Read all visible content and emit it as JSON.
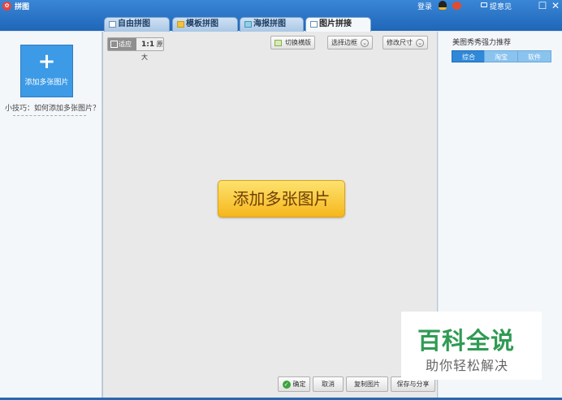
{
  "window": {
    "title": "拼图",
    "login_label": "登录",
    "feedback_label": "提意见",
    "maximize_glyph": "☐",
    "close_glyph": "✕",
    "accent_color": "#2c74c6"
  },
  "tabs": [
    {
      "label": "自由拼图",
      "icon": "free-collage-icon",
      "active": false
    },
    {
      "label": "模板拼图",
      "icon": "template-collage-icon",
      "active": false
    },
    {
      "label": "海报拼图",
      "icon": "poster-collage-icon",
      "active": false
    },
    {
      "label": "图片拼接",
      "icon": "image-stitch-icon",
      "active": true
    }
  ],
  "left_panel": {
    "add_glyph": "+",
    "add_button_label": "添加多张图片",
    "tip": "小技巧：如何添加多张图片？"
  },
  "canvas_toolbar": {
    "fit_label": "适应",
    "original_ratio": "1:1",
    "original_label": "原大",
    "switch_label": "切换横版",
    "border_label": "选择边框",
    "resize_label": "修改尺寸",
    "chevron_glyph": "⌄"
  },
  "canvas": {
    "add_images_label": "添加多张图片"
  },
  "bottom_bar": {
    "confirm_label": "确定",
    "confirm_glyph": "✓",
    "cancel_label": "取消",
    "copy_label": "复制图片",
    "save_label": "保存与分享"
  },
  "right_panel": {
    "title": "美图秀秀强力推荐",
    "tabs": [
      {
        "label": "综合",
        "active": true
      },
      {
        "label": "淘宝",
        "active": false
      },
      {
        "label": "软件",
        "active": false
      }
    ]
  },
  "watermark": {
    "title": "百科全说",
    "subtitle": "助你轻松解决",
    "color": "#2f9b53"
  }
}
